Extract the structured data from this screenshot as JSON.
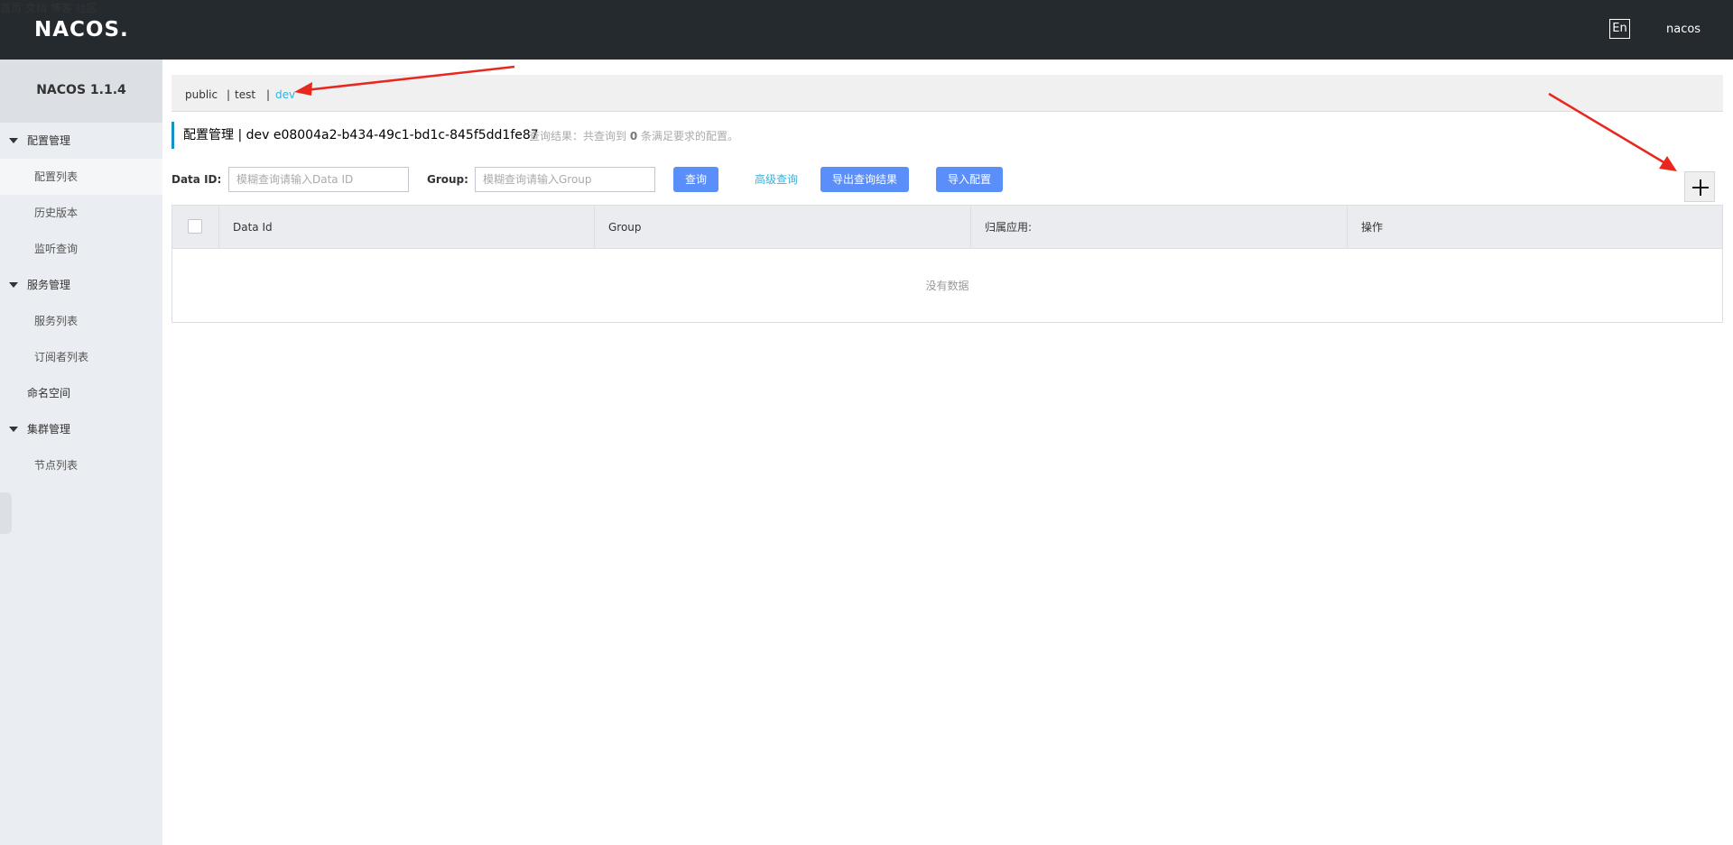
{
  "header": {
    "logo": "NACOS.",
    "nav": [
      "首页",
      "文档",
      "博客",
      "社区"
    ],
    "lang": "En",
    "user": "nacos"
  },
  "sidebar": {
    "version": "NACOS 1.1.4",
    "groups": [
      {
        "label": "配置管理",
        "items": [
          "配置列表",
          "历史版本",
          "监听查询"
        ]
      },
      {
        "label": "服务管理",
        "items": [
          "服务列表",
          "订阅者列表"
        ]
      },
      {
        "label": "命名空间"
      },
      {
        "label": "集群管理",
        "items": [
          "节点列表"
        ]
      }
    ]
  },
  "namespaces": {
    "items": [
      "public",
      "test",
      "dev"
    ],
    "separator": "|",
    "active": "dev"
  },
  "title": {
    "main": "配置管理 | dev e08004a2-b434-49c1-bd1c-845f5dd1fe87",
    "result_prefix": "查询结果：共查询到",
    "result_count": "0",
    "result_suffix": "条满足要求的配置。"
  },
  "filters": {
    "data_id_label": "Data ID:",
    "data_id_placeholder": "模糊查询请输入Data ID",
    "group_label": "Group:",
    "group_placeholder": "模糊查询请输入Group",
    "query_button": "查询",
    "advanced_query": "高级查询",
    "export_button": "导出查询结果",
    "import_button": "导入配置"
  },
  "table": {
    "columns": [
      "Data Id",
      "Group",
      "归属应用:",
      "操作"
    ],
    "empty_text": "没有数据"
  },
  "colors": {
    "topbar": "#252a2f",
    "accent": "#33b2e0",
    "primary_button": "#5a8ef9",
    "annotation_arrow": "#e8281e"
  }
}
